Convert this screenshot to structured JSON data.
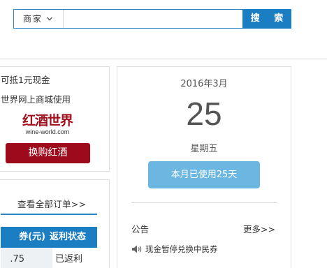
{
  "search": {
    "type_label": "商家",
    "placeholder": "",
    "button_label": "搜 索"
  },
  "promo": {
    "line1": "可抵1元现金",
    "line2": "世界网上商城使用",
    "logo_cn": "红酒世界",
    "logo_en": "wine-world.com",
    "button_label": "换购红酒"
  },
  "orders": {
    "view_all_label": "查看全部订单>>",
    "columns": [
      "券(元)",
      "返利状态"
    ],
    "rows": [
      {
        "amount": ".75",
        "status": "已返利"
      }
    ]
  },
  "calendar": {
    "month": "2016年3月",
    "day": "25",
    "weekday": "星期五",
    "used_label": "本月已使用25天"
  },
  "notice": {
    "title": "公告",
    "more_label": "更多>>",
    "items": [
      "现金暂停兑换中民券"
    ]
  },
  "colors": {
    "primary_blue": "#1b7dc2",
    "light_blue": "#6cb7e1",
    "wine_red": "#9c0a1c"
  }
}
